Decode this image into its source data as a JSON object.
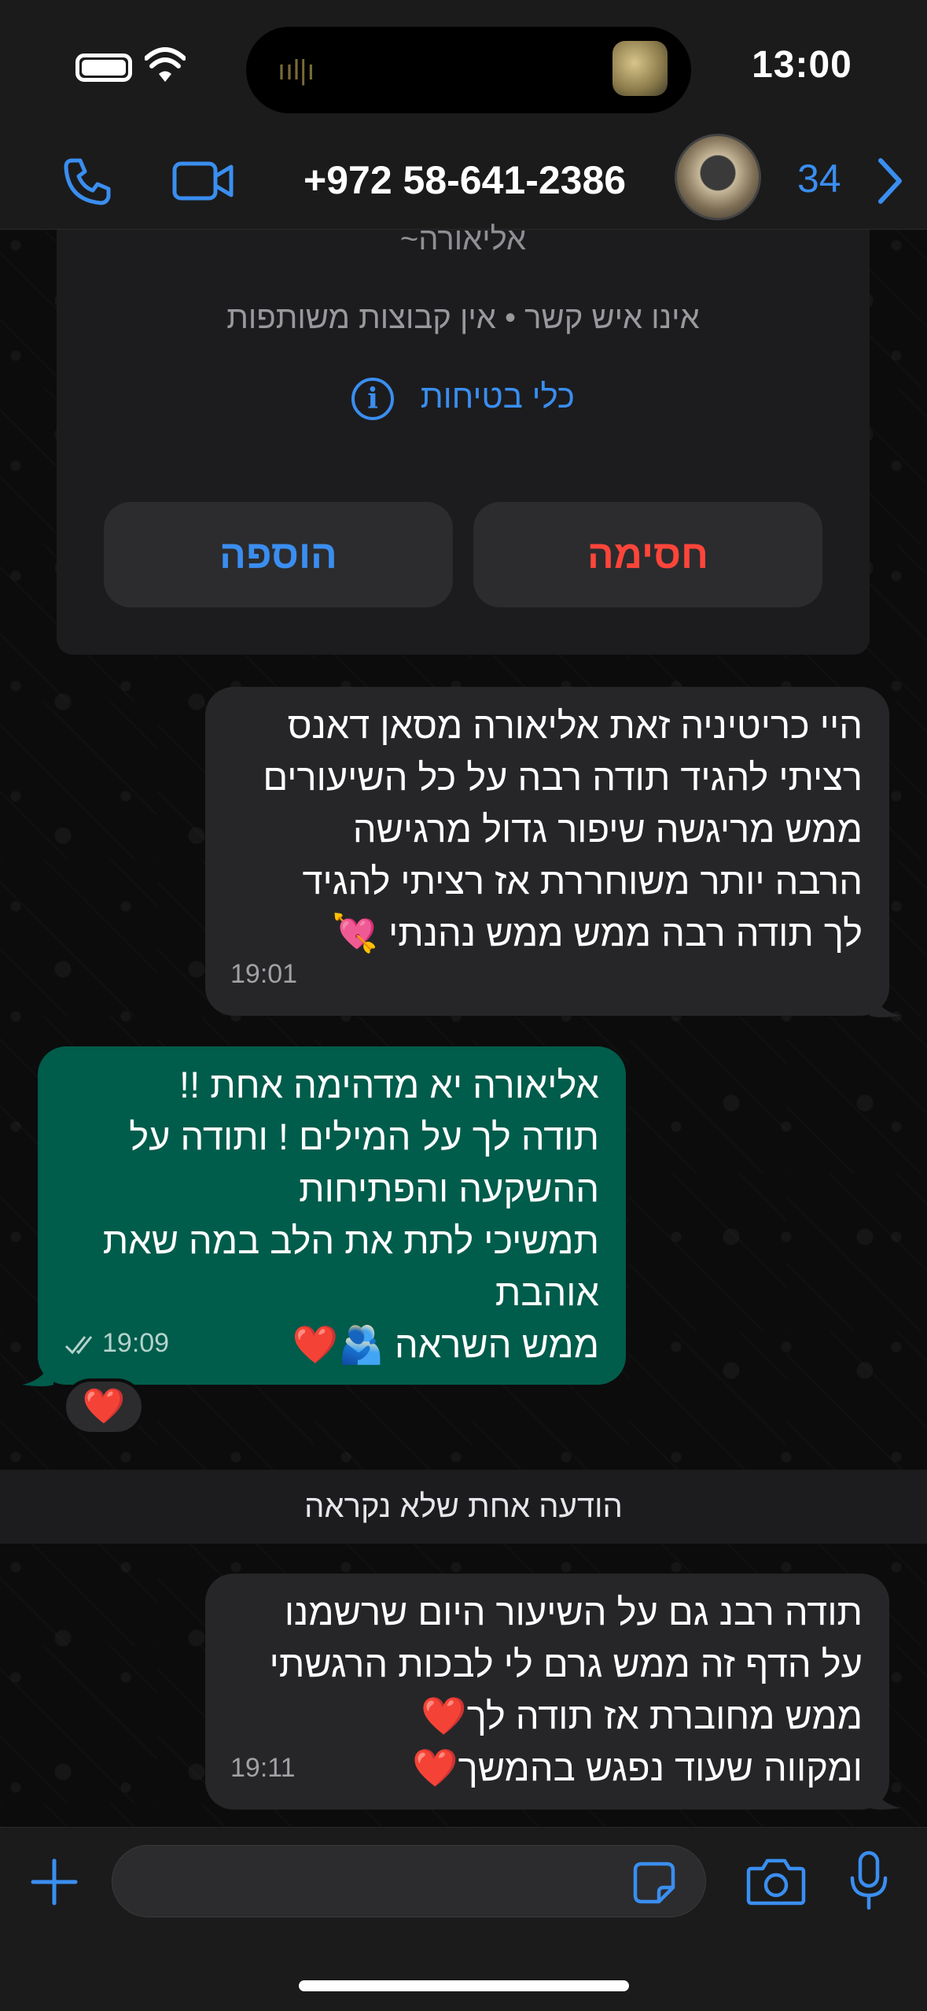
{
  "status_bar": {
    "time": "13:00"
  },
  "header": {
    "contact_name": "+972 58-641-2386",
    "unread_count": "34",
    "accent_color": "#3a8ef0"
  },
  "info_card": {
    "name": "~אליאורה",
    "subtitle": "אינו איש קשר • אין קבוצות משותפות",
    "safety_label": "כלי בטיחות",
    "add_button": "הוספה",
    "block_button": "חסימה"
  },
  "messages": [
    {
      "direction": "incoming",
      "lines": [
        "היי כריטיניה זאת אליאורה מסאן דאנס",
        "רציתי להגיד תודה רבה על כל השיעורים",
        "ממש מריגשה שיפור גדול מרגישה",
        "הרבה יותר משוחררת אז רציתי להגיד",
        "לך תודה רבה ממש ממש נהנתי 💘"
      ],
      "time": "19:01"
    },
    {
      "direction": "outgoing",
      "lines": [
        "אליאורה יא מדהימה אחת !!",
        "תודה לך על המילים ! ותודה על",
        "ההשקעה והפתיחות",
        "תמשיכי לתת את הלב במה שאת",
        "אוהבת",
        "ממש השראה 🫂❤️"
      ],
      "time": "19:09",
      "reaction": "❤️"
    },
    {
      "direction": "incoming",
      "lines": [
        "תודה רבנ גם על השיעור היום שרשמנו",
        "על הדף זה ממש גרם לי לבכות הרגשתי",
        "ממש מחוברת אז תודה לך❤️",
        "ומקווה שעוד נפגש בהמשך❤️"
      ],
      "time": "19:11"
    }
  ],
  "unread_divider": "הודעה אחת שלא נקראה"
}
